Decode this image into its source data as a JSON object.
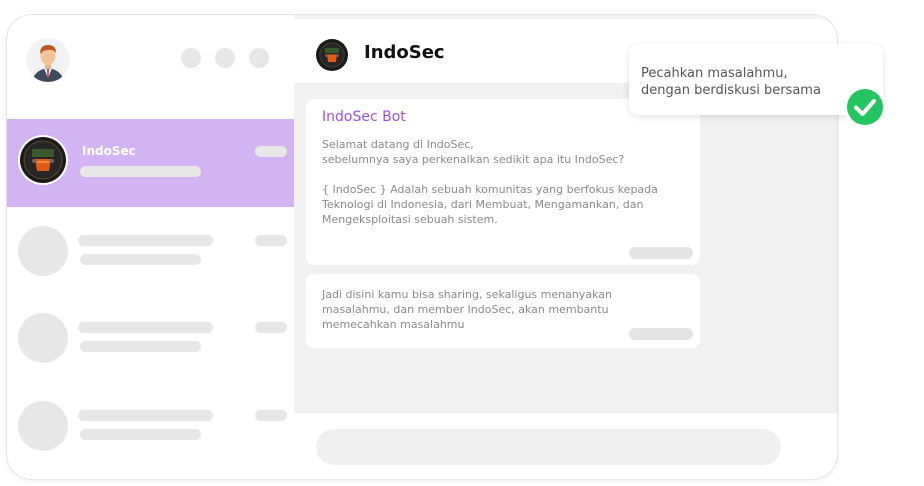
{
  "app": {
    "title": "IndoSec"
  },
  "sidebar": {
    "active_chat": {
      "name": "IndoSec"
    }
  },
  "conversation": {
    "header_title": "IndoSec",
    "messages": [
      {
        "sender": "IndoSec Bot",
        "paragraphs": [
          "Selamat datang di IndoSec,\nsebelumnya saya perkenalkan sedikit apa itu IndoSec?",
          "{ IndoSec } Adalah sebuah komunitas yang berfokus kepada\nTeknologi di Indonesia, dari Membuat, Mengamankan, dan\nMengeksploitasi sebuah sistem."
        ]
      },
      {
        "paragraphs": [
          "Jadi disini kamu bisa sharing, sekaligus menanyakan\nmasalahmu, dan member IndoSec, akan membantu\nmemecahkan masalahmu"
        ]
      }
    ]
  },
  "toast": {
    "text": "Pecahkan masalahmu,\ndengan berdiskusi bersama"
  },
  "colors": {
    "accent": "#a14fe0",
    "active_chat_bg": "#d4b3f2",
    "check_green": "#22c55e"
  },
  "icons": [
    "user-avatar-icon",
    "group-logo-icon",
    "check-icon"
  ]
}
